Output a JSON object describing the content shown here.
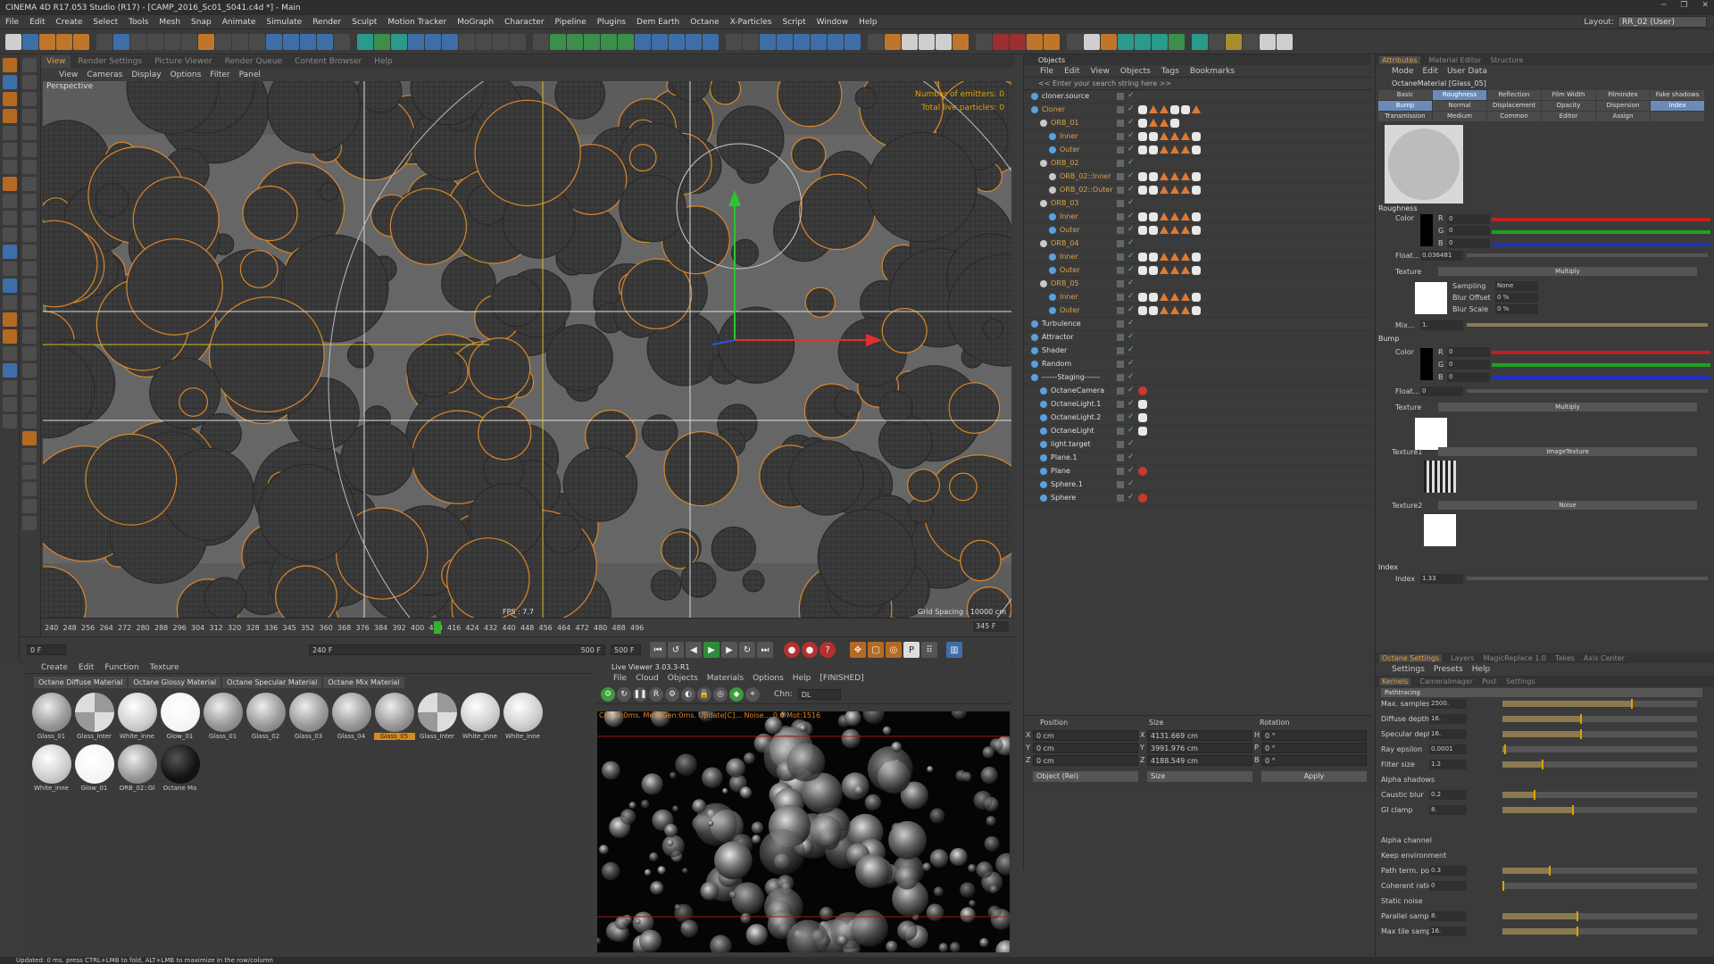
{
  "title": "CINEMA 4D R17.053 Studio (R17) - [CAMP_2016_Sc01_S041.c4d *] - Main",
  "menu": [
    "File",
    "Edit",
    "Create",
    "Select",
    "Tools",
    "Mesh",
    "Snap",
    "Animate",
    "Simulate",
    "Render",
    "Sculpt",
    "Motion Tracker",
    "MoGraph",
    "Character",
    "Pipeline",
    "Plugins",
    "Dem Earth",
    "Octane",
    "X-Particles",
    "Script",
    "Window",
    "Help"
  ],
  "layout_label": "Layout:",
  "layout_value": "RR_02 (User)",
  "vp_tabs": [
    "View",
    "Render Settings",
    "Picture Viewer",
    "Render Queue",
    "Content Browser",
    "Help"
  ],
  "vp_menu": [
    "View",
    "Cameras",
    "Display",
    "Options",
    "Filter",
    "Panel"
  ],
  "vp_label": "Perspective",
  "vp_emitters": "Number of emitters: 0",
  "vp_particles": "Total live particles: 0",
  "vp_fps": "FPS : 7.7",
  "vp_grid": "Grid Spacing : 10000 cm",
  "timeline_ticks": [
    "240",
    "248",
    "256",
    "264",
    "272",
    "280",
    "288",
    "296",
    "304",
    "312",
    "320",
    "328",
    "336",
    "345",
    "352",
    "360",
    "368",
    "376",
    "384",
    "392",
    "400",
    "408",
    "416",
    "424",
    "432",
    "440",
    "448",
    "456",
    "464",
    "472",
    "480",
    "488",
    "496"
  ],
  "timeline_end": "345 F",
  "play": {
    "start": "0 F",
    "range_left": "240 F",
    "range_right": "500 F",
    "end": "500 F"
  },
  "mat_menu": [
    "Create",
    "Edit",
    "Function",
    "Texture"
  ],
  "mat_tabs": [
    "Octane Diffuse Material",
    "Octane Glossy Material",
    "Octane Specular Material",
    "Octane Mix Material"
  ],
  "materials": [
    {
      "name": "Glass_01",
      "style": "glass"
    },
    {
      "name": "Glass_Inter",
      "style": "checker"
    },
    {
      "name": "White_inne",
      "style": "white"
    },
    {
      "name": "Glow_01",
      "style": "glow"
    },
    {
      "name": "Glass_01",
      "style": "glass"
    },
    {
      "name": "Glass_02",
      "style": "glass"
    },
    {
      "name": "Glass_03",
      "style": "glass"
    },
    {
      "name": "Glass_04",
      "style": "glass"
    },
    {
      "name": "Glass_05",
      "style": "glass",
      "selected": true
    },
    {
      "name": "Glass_Inter",
      "style": "checker"
    },
    {
      "name": "White_inne",
      "style": "white"
    },
    {
      "name": "White_inne",
      "style": "white"
    },
    {
      "name": "White_inne",
      "style": "white"
    },
    {
      "name": "Glow_01",
      "style": "glow"
    },
    {
      "name": "ORB_02::Gl",
      "style": "glass"
    },
    {
      "name": "Octane Ma",
      "style": "dark"
    }
  ],
  "live_title": "Live Viewer 3.03.3-R1",
  "live_menu": [
    "File",
    "Cloud",
    "Objects",
    "Materials",
    "Options",
    "Help",
    "[FINISHED]"
  ],
  "live_chn_label": "Chn:",
  "live_chn": "DL",
  "live_status": "Check:0ms. MeshGen:0ms. Update[C]...  Noise...  0.0 Mot:1516",
  "objects_title": "Objects",
  "obj_menu": [
    "File",
    "Edit",
    "View",
    "Objects",
    "Tags",
    "Bookmarks"
  ],
  "obj_search": "<< Enter your search string here >>",
  "objects": [
    {
      "name": "cloner.source",
      "indent": 0,
      "orange": false
    },
    {
      "name": "Cloner",
      "indent": 0,
      "orange": true
    },
    {
      "name": "ORB_01",
      "indent": 1,
      "orange": true
    },
    {
      "name": "Inner",
      "indent": 2,
      "orange": true
    },
    {
      "name": "Outer",
      "indent": 2,
      "orange": true
    },
    {
      "name": "ORB_02",
      "indent": 1,
      "orange": true
    },
    {
      "name": "ORB_02::Inner",
      "indent": 2,
      "orange": true
    },
    {
      "name": "ORB_02::Outer",
      "indent": 2,
      "orange": true
    },
    {
      "name": "ORB_03",
      "indent": 1,
      "orange": true
    },
    {
      "name": "Inner",
      "indent": 2,
      "orange": true
    },
    {
      "name": "Outer",
      "indent": 2,
      "orange": true
    },
    {
      "name": "ORB_04",
      "indent": 1,
      "orange": true
    },
    {
      "name": "Inner",
      "indent": 2,
      "orange": true
    },
    {
      "name": "Outer",
      "indent": 2,
      "orange": true
    },
    {
      "name": "ORB_05",
      "indent": 1,
      "orange": true
    },
    {
      "name": "Inner",
      "indent": 2,
      "orange": true
    },
    {
      "name": "Outer",
      "indent": 2,
      "orange": true
    },
    {
      "name": "Turbulence",
      "indent": 0,
      "orange": false
    },
    {
      "name": "Attractor",
      "indent": 0,
      "orange": false
    },
    {
      "name": "Shader",
      "indent": 0,
      "orange": false
    },
    {
      "name": "Random",
      "indent": 0,
      "orange": false
    },
    {
      "name": "------Staging------",
      "indent": 0,
      "orange": false
    },
    {
      "name": "OctaneCamera",
      "indent": 1,
      "orange": false
    },
    {
      "name": "OctaneLight.1",
      "indent": 1,
      "orange": false
    },
    {
      "name": "OctaneLight.2",
      "indent": 1,
      "orange": false
    },
    {
      "name": "OctaneLight",
      "indent": 1,
      "orange": false
    },
    {
      "name": "light.target",
      "indent": 1,
      "orange": false
    },
    {
      "name": "Plane.1",
      "indent": 1,
      "orange": false
    },
    {
      "name": "Plane",
      "indent": 1,
      "orange": false
    },
    {
      "name": "Sphere.1",
      "indent": 1,
      "orange": false
    },
    {
      "name": "Sphere",
      "indent": 1,
      "orange": false
    }
  ],
  "coords": {
    "h_pos": "Position",
    "h_size": "Size",
    "h_rot": "Rotation",
    "px": "0 cm",
    "py": "0 cm",
    "pz": "0 cm",
    "sx": "4131.669 cm",
    "sy": "3991.976 cm",
    "sz": "4188.549 cm",
    "rh": "0 °",
    "rp": "0 °",
    "rb": "0 °",
    "mode": "Object (Rel)",
    "smode": "Size",
    "apply": "Apply"
  },
  "attr_tabs": [
    "Attributes",
    "Material Editor",
    "Structure"
  ],
  "attr_menu": [
    "Mode",
    "Edit",
    "User Data"
  ],
  "attr_header": "OctaneMaterial [Glass_05]",
  "attr_grid": [
    "Basic",
    "Roughness",
    "Reflection",
    "Film Width",
    "Filmindex",
    "Fake shadows",
    "Bump",
    "Normal",
    "Displacement",
    "Opacity",
    "Dispersion",
    "Index",
    "Transmission",
    "Medium",
    "Common",
    "Editor",
    "Assign",
    ""
  ],
  "roughness": {
    "title": "Roughness",
    "color": "Color",
    "r": "0",
    "g": "0",
    "b": "0",
    "float_label": "Float...",
    "float": "0.036481",
    "texture": "Texture",
    "multiply": "Multiply",
    "sampling": "Sampling",
    "none": "None",
    "blur_offset": "Blur Offset",
    "bo": "0 %",
    "blur_scale": "Blur Scale",
    "bs": "0 %",
    "mix": "Mix...",
    "mixv": "1."
  },
  "bump": {
    "title": "Bump",
    "color": "Color",
    "r": "0",
    "g": "0",
    "b": "0",
    "float_label": "Float...",
    "float": "0",
    "texture": "Texture",
    "multiply": "Multiply",
    "texture1": "Texture1",
    "imagetex": "ImageTexture",
    "texture2": "Texture2",
    "noise": "Noise"
  },
  "index": {
    "title": "Index",
    "label": "Index",
    "value": "1.33"
  },
  "oct_tabs": [
    "Octane Settings",
    "Layers",
    "MagicReplace 1.0",
    "Takes",
    "Axis Center"
  ],
  "oct_menu": [
    "Settings",
    "Presets",
    "Help"
  ],
  "oct_sub": [
    "Kernels",
    "CameraImager",
    "Post",
    "Settings"
  ],
  "kernel": "Pathtracing",
  "kernel_rows": [
    {
      "label": "Max. samples",
      "value": "2500.",
      "fill": 0.66
    },
    {
      "label": "Diffuse depth",
      "value": "16.",
      "fill": 0.4
    },
    {
      "label": "Specular depth",
      "value": "16.",
      "fill": 0.4
    },
    {
      "label": "Ray epsilon",
      "value": "0.0001",
      "fill": 0.01
    },
    {
      "label": "Filter size",
      "value": "1.2",
      "fill": 0.2
    },
    {
      "label": "Alpha shadows",
      "value": "",
      "fill": -1
    },
    {
      "label": "Caustic blur",
      "value": "0.2",
      "fill": 0.16
    },
    {
      "label": "GI clamp",
      "value": "8.",
      "fill": 0.36
    },
    {
      "label": "",
      "value": "",
      "fill": -1
    },
    {
      "label": "Alpha channel",
      "value": "",
      "fill": -1
    },
    {
      "label": "Keep environment",
      "value": "",
      "fill": -1
    },
    {
      "label": "Path term. power",
      "value": "0.3",
      "fill": 0.24
    },
    {
      "label": "Coherent ratio",
      "value": "0",
      "fill": 0.0
    },
    {
      "label": "Static noise",
      "value": "",
      "fill": -1
    },
    {
      "label": "Parallel samples",
      "value": "8.",
      "fill": 0.38
    },
    {
      "label": "Max tile samples",
      "value": "16.",
      "fill": 0.38
    }
  ],
  "status": "Updated: 0 ms.      press CTRL+LMB to fold, ALT+LMB to maximize in the row/column",
  "accent": "#d9a24a"
}
